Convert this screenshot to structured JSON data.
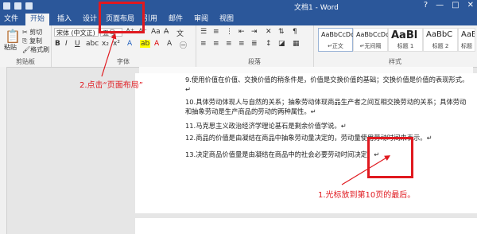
{
  "window": {
    "title": "文档1 - Word",
    "controls": [
      "?",
      "—",
      "□",
      "✕"
    ]
  },
  "tabs": [
    {
      "label": "文件"
    },
    {
      "label": "开始"
    },
    {
      "label": "插入"
    },
    {
      "label": "设计"
    },
    {
      "label": "页面布局"
    },
    {
      "label": "引用"
    },
    {
      "label": "邮件"
    },
    {
      "label": "审阅"
    },
    {
      "label": "视图"
    }
  ],
  "ribbon": {
    "clipboard": {
      "cut": "剪切",
      "copy": "复制",
      "paste": "粘贴",
      "format_painter": "格式刷",
      "label": "剪贴板"
    },
    "font": {
      "name": "宋体 (中文正)",
      "size": "五号",
      "label": "字体"
    },
    "paragraph": {
      "label": "段落"
    },
    "styles": {
      "label": "样式",
      "items": [
        {
          "sample": "AaBbCcDc",
          "name": "↵正文"
        },
        {
          "sample": "AaBbCcDc",
          "name": "↵无间隔"
        },
        {
          "sample": "AaBl",
          "name": "标题 1"
        },
        {
          "sample": "AaBbC",
          "name": "标题 2"
        },
        {
          "sample": "AaBbC",
          "name": "标题"
        }
      ]
    }
  },
  "document": {
    "paragraphs": [
      "9.使用价值在价值、交换价值的稍条件是，价值是交换价值的基础；交换价值是价值的表现形式。↵",
      "10.具体劳动体现人与自然的关系；抽象劳动体现商品生产者之间互相交换劳动的关系；具体劳动和抽象劳动是生产商品的劳动的两种属性。↵",
      "11.马克思主义政治经济学理论基石是剩余价值学说。↵",
      "12.商品的价值是由凝结在商品中抽象劳动量决定的，劳动量使用劳动时间来表示。↵",
      "13.决定商品价值量是由凝结在商品中的社会必要劳动时间决定。↵"
    ]
  },
  "annotations": {
    "step2": "2.点击“页面布局”",
    "step1": "1.光标放到第10页的最后。"
  },
  "colors": {
    "accent": "#2b579a",
    "annotation": "#e0191f"
  }
}
